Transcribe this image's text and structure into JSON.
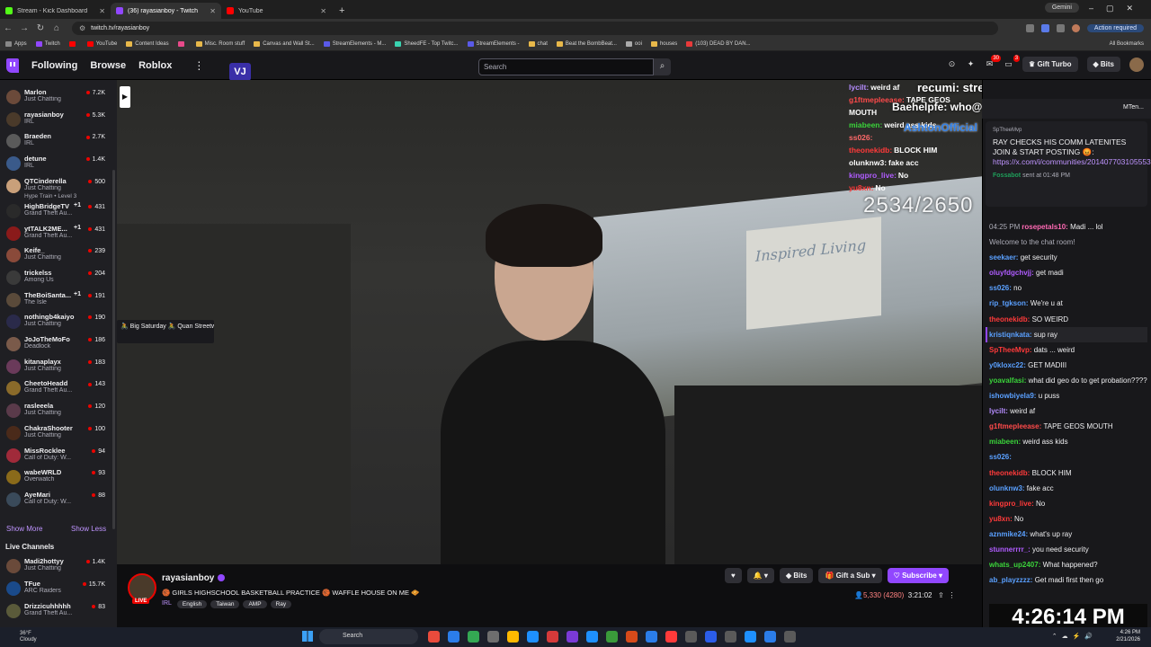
{
  "browser": {
    "tabs": [
      {
        "title": "Stream - Kick Dashboard",
        "color": "#53fc18",
        "active": false
      },
      {
        "title": "(36) rayasianboy - Twitch",
        "color": "#9147ff",
        "active": true
      },
      {
        "title": "YouTube",
        "color": "#ff0000",
        "active": false
      }
    ],
    "gemini": "Gemini",
    "url": "twitch.tv/rayasianboy",
    "action_required": "Action required",
    "bookmarks": [
      "Apps",
      "Twitch",
      "",
      "YouTube",
      "Content Ideas",
      "",
      "Misc. Room stuff",
      "Canvas and Wall St...",
      "StreamElements - M...",
      "SheedFE - Top Twitc...",
      "StreamElements -",
      "chat",
      "Beat the BombBeat...",
      "ooi",
      "houses",
      "(103) DEAD BY DAN..."
    ],
    "all_bookmarks": "All Bookmarks"
  },
  "twitch_nav": {
    "following": "Following",
    "browse": "Browse",
    "roblox": "Roblox",
    "more": "⋮",
    "vj": "VJ",
    "search_placeholder": "Search",
    "badges": {
      "notifications": "30",
      "whispers": "3"
    },
    "gift_turbo": "Gift Turbo",
    "bits": "Bits"
  },
  "sidebar": {
    "followed": [
      {
        "name": "Marlon",
        "category": "Just Chatting",
        "viewers": "7.2K",
        "plus": "",
        "color": "#6b4a3a"
      },
      {
        "name": "rayasianboy",
        "category": "IRL",
        "viewers": "5.3K",
        "plus": "",
        "color": "#4a3a2a"
      },
      {
        "name": "Braeden",
        "category": "IRL",
        "viewers": "2.7K",
        "plus": "",
        "color": "#5a5a5a"
      },
      {
        "name": "detune",
        "category": "IRL",
        "viewers": "1.4K",
        "plus": "",
        "color": "#3a5a8a"
      },
      {
        "name": "QTCinderella",
        "category": "Just Chatting",
        "viewers": "500",
        "plus": "",
        "color": "#c9a07a",
        "hype": "Hype Train • Level 3"
      },
      {
        "name": "HighBridgeTV",
        "category": "Grand Theft Au...",
        "viewers": "431",
        "plus": "+1",
        "color": "#2a2a2a"
      },
      {
        "name": "ytTALK2ME...",
        "category": "Grand Theft Au...",
        "viewers": "431",
        "plus": "+1",
        "color": "#8a1a1a"
      },
      {
        "name": "Keife_",
        "category": "Just Chatting",
        "viewers": "239",
        "plus": "",
        "color": "#8a4a3a"
      },
      {
        "name": "trickelss",
        "category": "Among Us",
        "viewers": "204",
        "plus": "",
        "color": "#3a3a3a"
      },
      {
        "name": "TheBoiSanta...",
        "category": "The Isle",
        "viewers": "191",
        "plus": "+1",
        "color": "#5a4a3a"
      },
      {
        "name": "nothingb4kaiyo",
        "category": "Just Chatting",
        "viewers": "190",
        "plus": "",
        "color": "#2a2a4a"
      },
      {
        "name": "JoJoTheMoFo",
        "category": "Deadlock",
        "viewers": "186",
        "plus": "",
        "color": "#7a5a4a"
      },
      {
        "name": "kitanaplayx",
        "category": "Just Chatting",
        "viewers": "183",
        "plus": "",
        "color": "#6a3a5a"
      },
      {
        "name": "CheetoHeadd",
        "category": "Grand Theft Au...",
        "viewers": "143",
        "plus": "",
        "color": "#8a6a2a"
      },
      {
        "name": "rasleeela",
        "category": "Just Chatting",
        "viewers": "120",
        "plus": "",
        "color": "#5a3a4a"
      },
      {
        "name": "ChakraShooter",
        "category": "Just Chatting",
        "viewers": "100",
        "plus": "",
        "color": "#4a2a1a"
      },
      {
        "name": "MissRocklee",
        "category": "Call of Duty: W...",
        "viewers": "94",
        "plus": "",
        "color": "#a02a3a"
      },
      {
        "name": "wabeWRLD",
        "category": "Overwatch",
        "viewers": "93",
        "plus": "",
        "color": "#8a6a1a"
      },
      {
        "name": "AyeMari",
        "category": "Call of Duty: W...",
        "viewers": "88",
        "plus": "",
        "color": "#3a4a5a"
      }
    ],
    "show_more": "Show More",
    "show_less": "Show Less",
    "live_title": "Live Channels",
    "live": [
      {
        "name": "Madi2hottyy",
        "category": "Just Chatting",
        "viewers": "1.4K",
        "plus": "",
        "color": "#6a4a3a"
      },
      {
        "name": "TFue",
        "category": "ARC Raiders",
        "viewers": "15.7K",
        "plus": "",
        "color": "#1a4a8a"
      },
      {
        "name": "Drizzicuhhhhh",
        "category": "Grand Theft Au...",
        "viewers": "83",
        "plus": "",
        "color": "#5a5a3a"
      }
    ],
    "tooltip": "🚴 Big Saturday 🚴 Quan Streetwear Martket 🚴 In M..."
  },
  "video": {
    "sign_text": "Inspired Living",
    "counter": "2534/2650"
  },
  "overlay_chat": [
    {
      "user": "lycilt:",
      "text": "weird af",
      "color": "#b58cff"
    },
    {
      "user": "g1ftmepleease:",
      "text": "TAPE GEOS",
      "color": "#ff4a4a"
    },
    {
      "user": "MOUTH",
      "text": "",
      "color": "#fff"
    },
    {
      "user": "miabeen:",
      "text": "weird ass kids",
      "color": "#3ad33a"
    },
    {
      "user": "ss026:",
      "text": "",
      "color": "#ff6a6a"
    },
    {
      "user": "theonekidb:",
      "text": "BLOCK HIM",
      "color": "#ff3a3a"
    },
    {
      "user": "olunknw3:",
      "text": "fake acc",
      "color": "#fff"
    },
    {
      "user": "kingpro_live:",
      "text": "No",
      "color": "#b05cff"
    },
    {
      "user": "yu8xn:",
      "text": "No",
      "color": "#ff3a3a"
    }
  ],
  "overlay_big": {
    "line1": "recumi: streets saying u a dead beat",
    "line2": "Baehelpfe: who@recumi",
    "line3": "AshtonOfficial"
  },
  "chat": {
    "top_right": "MTen...",
    "pin": {
      "header": "SpTheeMvp",
      "text": "RAY CHECKS HIS COMM LATENITES JOIN & START POSTING 😡:",
      "link": "https://x.com/i/communities/2014077031055536333",
      "bot": "Fossabot",
      "meta": " sent at 01:48 PM"
    },
    "messages": [
      {
        "ts": "04:25 PM",
        "user": "rosepetals10:",
        "text": "Madi ... lol",
        "color": "#ff69b4"
      },
      {
        "ts": "",
        "user": "",
        "text": "Welcome to the chat room!",
        "color": "#adadb8"
      },
      {
        "ts": "",
        "user": "seekaer:",
        "text": "get security",
        "color": "#5aa0ff"
      },
      {
        "ts": "",
        "user": "oluyfdgchvjj:",
        "text": "get madi",
        "color": "#b05cff"
      },
      {
        "ts": "",
        "user": "ss026:",
        "text": "no",
        "color": "#5aa0ff"
      },
      {
        "ts": "",
        "user": "rip_tgkson:",
        "text": "We're u at",
        "color": "#5aa0ff"
      },
      {
        "ts": "",
        "user": "theonekidb:",
        "text": "SO WEIRD",
        "color": "#ff3a3a"
      },
      {
        "ts": "",
        "user": "kristiqnkata:",
        "text": "sup ray",
        "color": "#5aa0ff",
        "first": true
      },
      {
        "ts": "",
        "user": "SpTheeMvp:",
        "text": "dats ... weird",
        "color": "#ff3a3a"
      },
      {
        "ts": "",
        "user": "y0kloxc22:",
        "text": "GET MADIII",
        "color": "#5aa0ff"
      },
      {
        "ts": "",
        "user": "yoavalfasi:",
        "text": "what did geo do to get probation????",
        "color": "#3ad33a"
      },
      {
        "ts": "",
        "user": "ishowbiyela9:",
        "text": "u puss",
        "color": "#5aa0ff"
      },
      {
        "ts": "",
        "user": "lycilt:",
        "text": "weird af",
        "color": "#b58cff"
      },
      {
        "ts": "",
        "user": "g1ftmepleease:",
        "text": "TAPE GEOS MOUTH",
        "color": "#ff4a4a"
      },
      {
        "ts": "",
        "user": "miabeen:",
        "text": "weird ass kids",
        "color": "#3ad33a"
      },
      {
        "ts": "",
        "user": "ss026:",
        "text": "",
        "color": "#5aa0ff"
      },
      {
        "ts": "",
        "user": "theonekidb:",
        "text": "BLOCK HIM",
        "color": "#ff3a3a"
      },
      {
        "ts": "",
        "user": "olunknw3:",
        "text": "fake acc",
        "color": "#5aa0ff"
      },
      {
        "ts": "",
        "user": "kingpro_live:",
        "text": "No",
        "color": "#ff3a3a"
      },
      {
        "ts": "",
        "user": "yu8xn:",
        "text": "No",
        "color": "#ff3a3a"
      },
      {
        "ts": "",
        "user": "aznmike24:",
        "text": "what's up ray",
        "color": "#5aa0ff"
      },
      {
        "ts": "",
        "user": "stunnerrrr_:",
        "text": "you need security",
        "color": "#b05cff"
      },
      {
        "ts": "",
        "user": "whats_up2407:",
        "text": "What happened?",
        "color": "#3ad33a"
      },
      {
        "ts": "",
        "user": "ab_playzzzz:",
        "text": "Get madi first then go",
        "color": "#5aa0ff"
      }
    ],
    "clock": "4:26:14 PM"
  },
  "stream_info": {
    "channel": "rayasianboy",
    "live": "LIVE",
    "title": "🏀 GIRLS HIGHSCHOOL BASKETBALL PRACTICE 🏀 WAFFLE HOUSE ON ME 🧇",
    "category": "IRL",
    "tags": [
      "English",
      "Taiwan",
      "AMP",
      "Ray"
    ],
    "bits": "Bits",
    "gift": "Gift a Sub",
    "subscribe": "Subscribe",
    "viewers": "5,330 (4280)",
    "uptime": "3:21:02"
  },
  "taskbar": {
    "temp": "36°F",
    "weather": "Cloudy",
    "search": "Search",
    "time": "4:26 PM",
    "date": "2/21/2026",
    "icon_colors": [
      "#e94b3c",
      "#2b7de9",
      "#34a853",
      "#6e6e6e",
      "#ffb900",
      "#1e90ff",
      "#d63a3a",
      "#7a3ad6",
      "#1e90ff",
      "#3a9a3a",
      "#d64a1a",
      "#2b7de9",
      "#ff3a3a",
      "#5a5a5a",
      "#2b5de9",
      "#5a5a5a",
      "#1e90ff",
      "#2b7de9",
      "#5a5a5a"
    ]
  }
}
